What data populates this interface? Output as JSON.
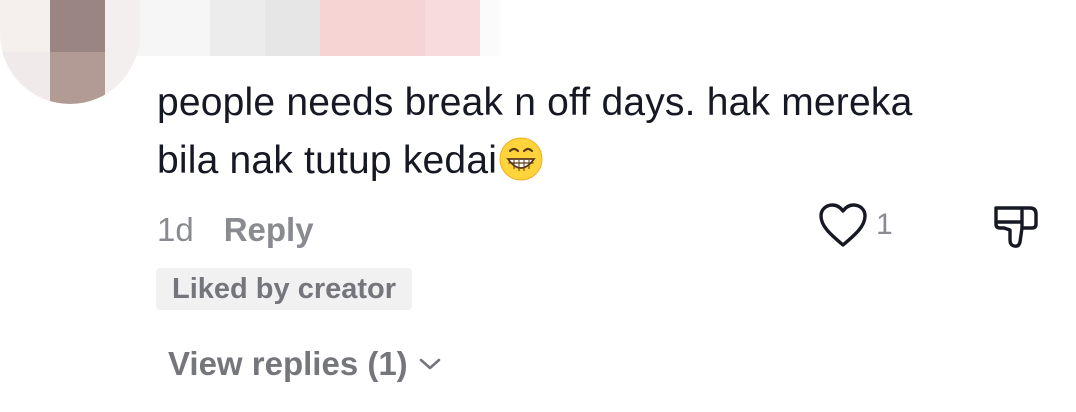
{
  "comment": {
    "text_line1": "people needs break n off days. hak mereka",
    "text_line2": "bila nak tutup kedai",
    "emoji": "grinning-face-emoji"
  },
  "meta": {
    "time": "1d",
    "reply_label": "Reply"
  },
  "likes": {
    "count": "1",
    "icon": "heart-outline-icon"
  },
  "dislike": {
    "icon": "thumbs-down-icon"
  },
  "badge": {
    "label": "Liked by creator"
  },
  "replies": {
    "label": "View replies (1)",
    "icon": "chevron-down-icon"
  },
  "colors": {
    "text_primary": "#161823",
    "text_secondary": "#8a8b91",
    "badge_bg": "#f1f1f2"
  }
}
